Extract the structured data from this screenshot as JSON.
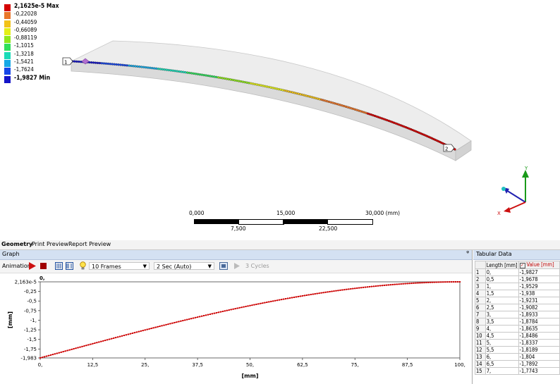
{
  "legend": {
    "items": [
      {
        "label": "2,1625e-5 Max",
        "color": "#d40000",
        "bold": true
      },
      {
        "label": "-0,22028",
        "color": "#e9762a"
      },
      {
        "label": "-0,44059",
        "color": "#f2c218"
      },
      {
        "label": "-0,66089",
        "color": "#e4ef16"
      },
      {
        "label": "-0,88119",
        "color": "#8ee81a"
      },
      {
        "label": "-1,1015",
        "color": "#2fe05b"
      },
      {
        "label": "-1,3218",
        "color": "#19dbb8"
      },
      {
        "label": "-1,5421",
        "color": "#16a9e6"
      },
      {
        "label": "-1,7624",
        "color": "#1646e8"
      },
      {
        "label": "-1,9827 Min",
        "color": "#1414c8",
        "bold": true
      }
    ]
  },
  "viewport": {
    "point_labels": [
      "1",
      "2"
    ],
    "triad_axis_label": "Y",
    "triad_x_label": "X"
  },
  "scalebar": {
    "top_labels": [
      "0,000",
      "15,000",
      "30,000 (mm)"
    ],
    "bottom_labels": [
      "7,500",
      "22,500"
    ]
  },
  "tabs": [
    "Geometry",
    "Print Preview",
    "Report Preview"
  ],
  "graph": {
    "title": "Graph",
    "animation_label": "Animation",
    "frames": "10 Frames",
    "duration": "2 Sec (Auto)",
    "cycles": "3 Cycles",
    "pin": "ᵠ"
  },
  "chart_data": {
    "type": "scatter",
    "xlabel": "[mm]",
    "ylabel": "[mm]",
    "xlim": [
      0,
      100
    ],
    "ylim": [
      -1.983,
      2.163e-05
    ],
    "x_ticks": [
      "0,",
      "12,5",
      "25,",
      "37,5",
      "50,",
      "62,5",
      "75,",
      "87,5",
      "100,"
    ],
    "y_ticks": [
      "2,163e-5",
      "-0,25",
      "-0,5",
      "-0,75",
      "-1,",
      "-1,25",
      "-1,5",
      "-1,75",
      "-1,983"
    ],
    "top_x_label": "0,",
    "color": "#cc0000",
    "model": "cantilever: y = -1.9827 * (1 - 1.5*(x/100) + 0.5*(x/100)^3), sampled every 0.5 mm"
  },
  "tabular": {
    "title": "Tabular Data",
    "headers": [
      "Length [mm]",
      "Value [mm]"
    ],
    "rows": [
      [
        "1",
        "0,",
        "-1,9827"
      ],
      [
        "2",
        "0,5",
        "-1,9678"
      ],
      [
        "3",
        "1,",
        "-1,9529"
      ],
      [
        "4",
        "1,5",
        "-1,938"
      ],
      [
        "5",
        "2,",
        "-1,9231"
      ],
      [
        "6",
        "2,5",
        "-1,9082"
      ],
      [
        "7",
        "3,",
        "-1,8933"
      ],
      [
        "8",
        "3,5",
        "-1,8784"
      ],
      [
        "9",
        "4,",
        "-1,8635"
      ],
      [
        "10",
        "4,5",
        "-1,8486"
      ],
      [
        "11",
        "5,",
        "-1,8337"
      ],
      [
        "12",
        "5,5",
        "-1,8189"
      ],
      [
        "13",
        "6,",
        "-1,804"
      ],
      [
        "14",
        "6,5",
        "-1,7892"
      ],
      [
        "15",
        "7,",
        "-1,7743"
      ]
    ]
  }
}
